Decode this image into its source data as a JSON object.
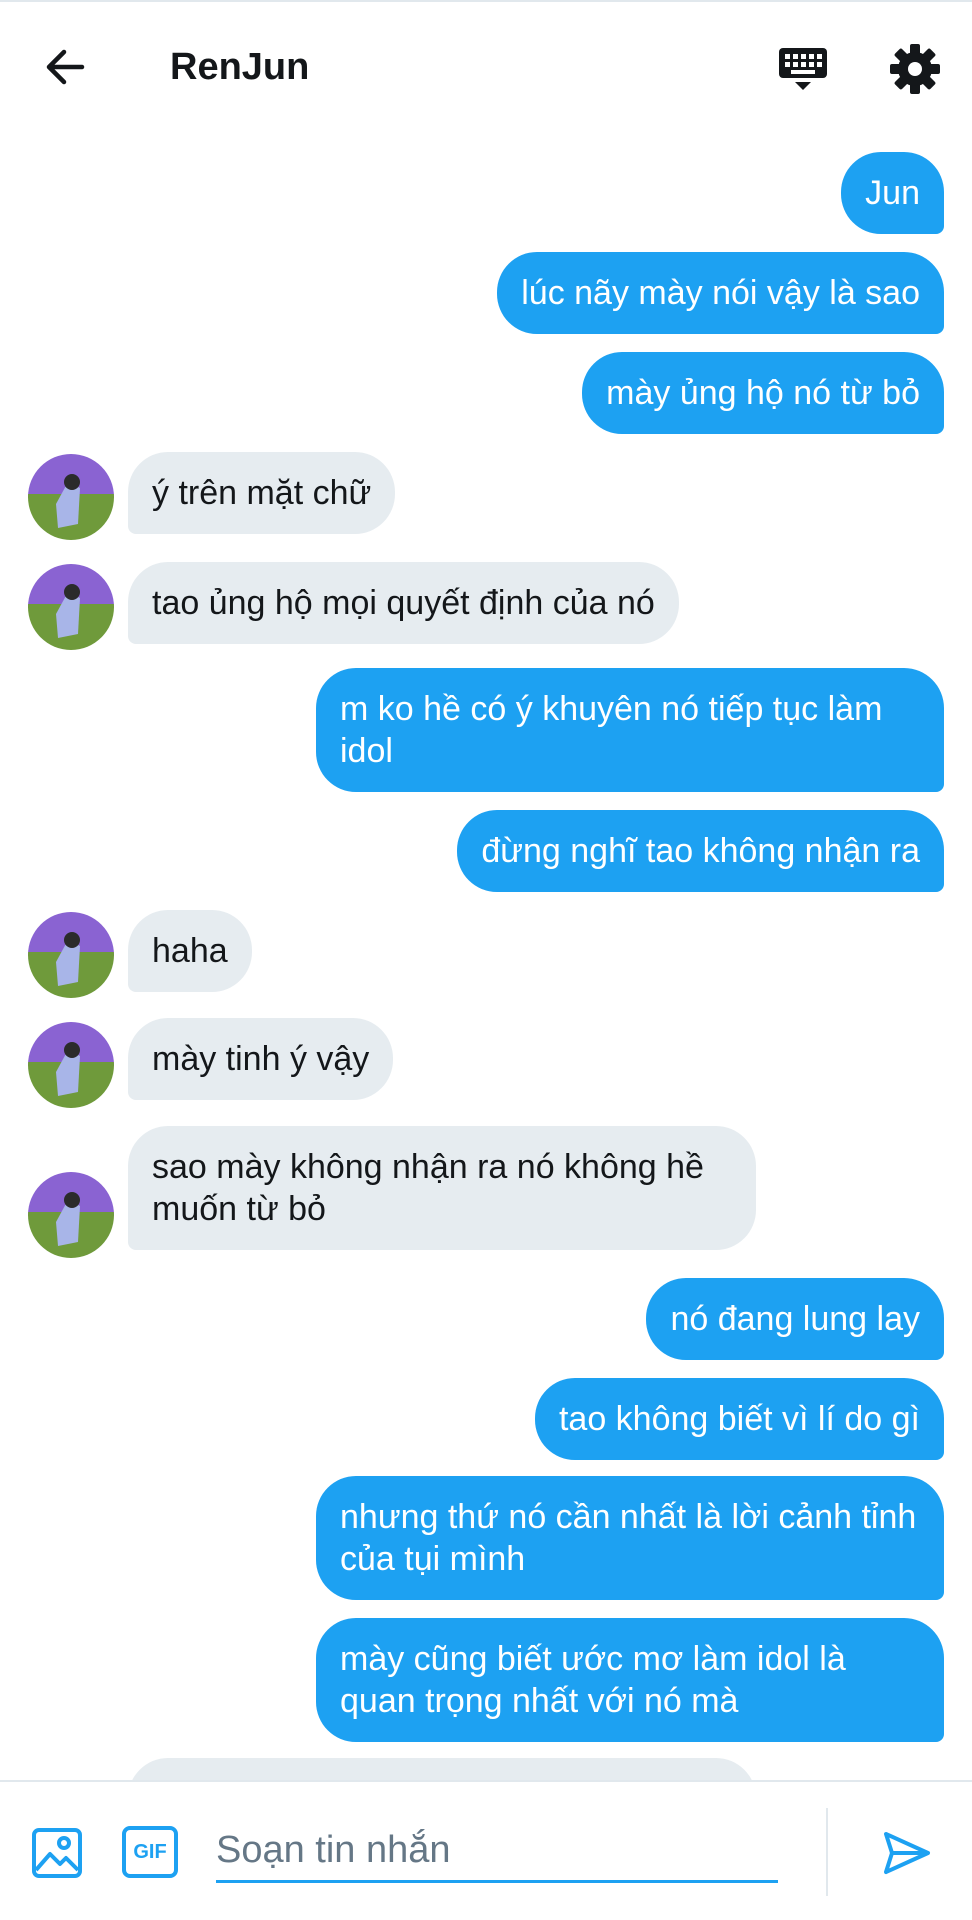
{
  "header": {
    "title": "RenJun",
    "icons": {
      "back": "arrow-left",
      "keyboard": "keyboard",
      "settings": "gear"
    }
  },
  "messages": [
    {
      "dir": "out",
      "text": "Jun"
    },
    {
      "dir": "out",
      "text": "lúc nãy mày nói vậy là sao"
    },
    {
      "dir": "out",
      "text": "mày ủng hộ nó từ bỏ"
    },
    {
      "dir": "in",
      "text": "ý trên mặt chữ"
    },
    {
      "dir": "in",
      "text": "tao ủng hộ mọi quyết định của nó"
    },
    {
      "dir": "out",
      "text": "m ko hề có ý khuyên nó tiếp tục làm idol"
    },
    {
      "dir": "out",
      "text": "đừng nghĩ tao không nhận ra"
    },
    {
      "dir": "in",
      "text": "haha"
    },
    {
      "dir": "in",
      "text": "mày tinh ý vậy"
    },
    {
      "dir": "in",
      "text": "sao mày không nhận ra nó không hề muốn từ bỏ"
    },
    {
      "dir": "out",
      "text": "nó đang lung lay"
    },
    {
      "dir": "out",
      "text": "tao không biết vì lí do gì"
    },
    {
      "dir": "out",
      "text": "nhưng thứ nó cần nhất là lời cảnh tỉnh của tụi mình"
    },
    {
      "dir": "out",
      "text": "mày cũng biết ước mơ làm idol là quan trọng nhất với nó mà"
    }
  ],
  "composer": {
    "placeholder": "Soạn tin nhắn",
    "gif_label": "GIF",
    "icons": {
      "image": "image",
      "send": "send"
    }
  },
  "colors": {
    "accent": "#1da1f2",
    "incoming_bubble": "#e6ecf0",
    "text": "#14171a",
    "placeholder": "#657786"
  }
}
